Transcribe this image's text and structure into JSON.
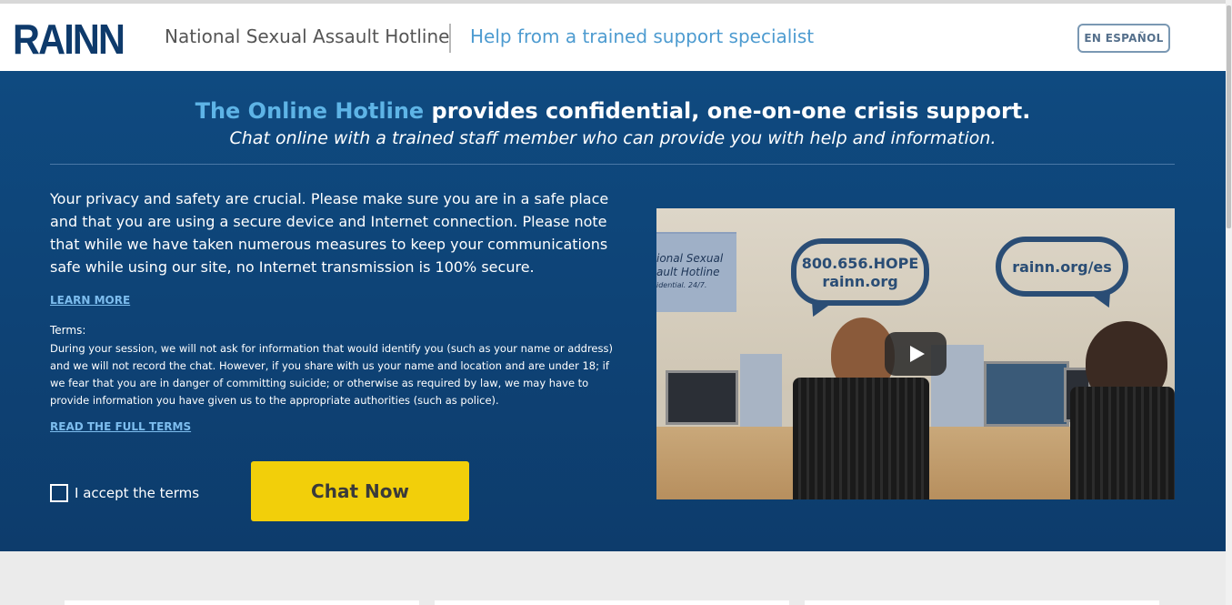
{
  "header": {
    "logo": "RAINN",
    "tagline": "National Sexual Assault Hotline",
    "help_text": "Help from a trained support specialist",
    "language_button": "EN ESPAÑOL"
  },
  "hero": {
    "headline_accent": "The Online Hotline",
    "headline_rest": " provides confidential, one-on-one crisis support.",
    "subhead": "Chat online with a trained staff member who can provide you with help and  information.",
    "privacy_text": "Your privacy and safety are crucial. Please make sure you are in a safe place and that you are using a secure device and Internet connection. Please note that while we have taken numerous measures to keep your communications safe while using our site, no Internet transmission is 100%  secure.",
    "learn_more": "LEARN MORE",
    "terms_label": "Terms:",
    "terms_text": "During your session, we will not ask for information that would identify you (such as your name or address) and we will not record the chat. However, if you share with us your name and location and are under 18; if we fear that you are in danger of committing suicide; or otherwise as required by law, we may have to provide information you have given us to the appropriate authorities (such as police).",
    "read_terms": "READ THE FULL TERMS",
    "accept_label": "I accept the terms",
    "chat_button": "Chat Now"
  },
  "video": {
    "sign_line1": "ional Sexual",
    "sign_line2": "ault Hotline",
    "sign_line3": "idential. 24/7.",
    "bubble1_line1": "800.656.HOPE",
    "bubble1_line2": "rainn.org",
    "bubble2": "rainn.org/es",
    "play_icon": "play-icon"
  },
  "colors": {
    "brand_navy": "#0e3a6b",
    "hero_bg": "#0f4a80",
    "accent_blue": "#5eb4e6",
    "chat_button": "#f2cf0a"
  }
}
